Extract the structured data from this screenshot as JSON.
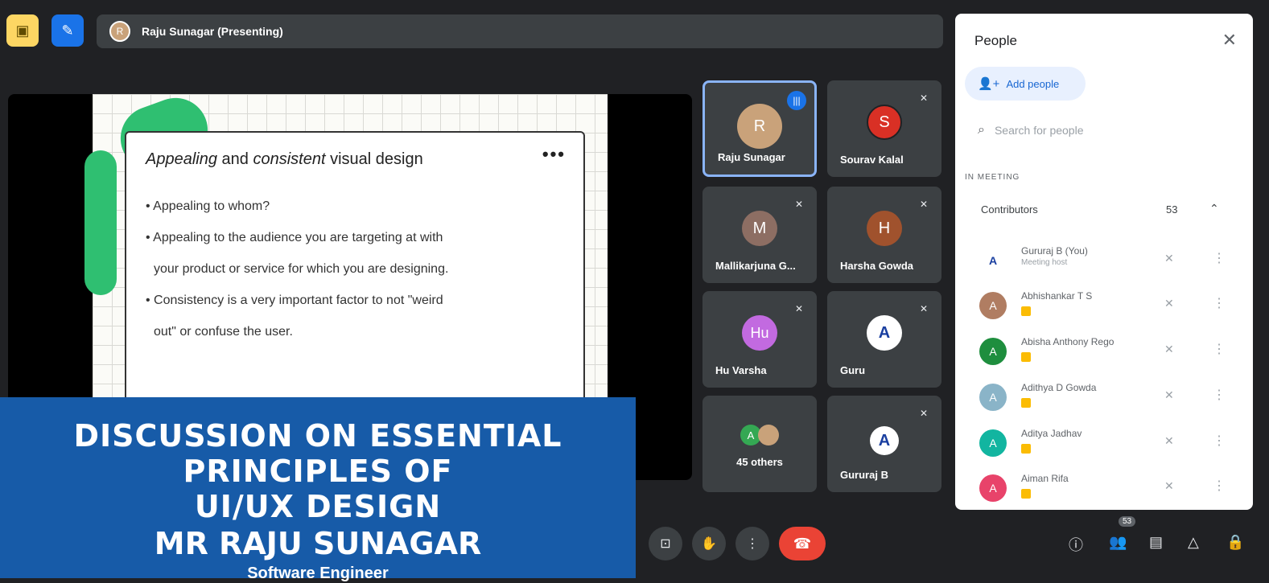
{
  "topbar": {
    "presenter_label": "Raju Sunagar (Presenting)",
    "presenter_initial": "R"
  },
  "slide": {
    "title_part1": "Appealing",
    "title_part2": " and ",
    "title_part3": "consistent",
    "title_part4": " visual design",
    "menu_dots": "•••",
    "bullets": [
      "• Appealing to whom?",
      "• Appealing to the audience you are targeting at with",
      "your product or service for which you are designing.",
      "• Consistency is a very important factor to not \"weird",
      "out\" or confuse the user."
    ]
  },
  "tiles": [
    {
      "name": "Raju Sunagar",
      "initial": "R",
      "color": "#c9a27a"
    },
    {
      "name": "Sourav Kalal",
      "initial": "S",
      "color": "#d93025"
    },
    {
      "name": "Mallikarjuna G...",
      "initial": "M",
      "color": "#8d6e63"
    },
    {
      "name": "Harsha Gowda",
      "initial": "H",
      "color": "#a0522d"
    },
    {
      "name": "Hu Varsha",
      "initial": "Hu",
      "color": "#c26ae0"
    },
    {
      "name": "Guru",
      "initial": "A",
      "color": "#ffffff"
    },
    {
      "name": "45 others",
      "initial": "A",
      "color": "#34a853"
    },
    {
      "name": "Gururaj B",
      "initial": "A",
      "color": "#ffffff"
    }
  ],
  "panel": {
    "title": "People",
    "close": "✕",
    "add_people": "Add people",
    "search_placeholder": "Search for people",
    "section": "IN MEETING",
    "contributors_label": "Contributors",
    "contributors_count": "53",
    "people": [
      {
        "name": "Gururaj B (You)",
        "sub": "Meeting host",
        "initial": "A",
        "color": "#ffffff"
      },
      {
        "name": "Abhishankar T S",
        "sub": "",
        "initial": "A",
        "color": "#b07d62"
      },
      {
        "name": "Abisha Anthony Rego",
        "sub": "",
        "initial": "A",
        "color": "#1e8e3e"
      },
      {
        "name": "Adithya D Gowda",
        "sub": "",
        "initial": "A",
        "color": "#8ab4c8"
      },
      {
        "name": "Aditya Jadhav",
        "sub": "",
        "initial": "A",
        "color": "#12b5a0"
      },
      {
        "name": "Aiman Rifa",
        "sub": "",
        "initial": "A",
        "color": "#e8436a"
      }
    ]
  },
  "controls": {
    "people_count": "53"
  },
  "banner": {
    "line1": "DISCUSSION ON ESSENTIAL PRINCIPLES OF",
    "line2": "UI/UX DESIGN",
    "line3": "MR RAJU SUNAGAR",
    "line4": "Software Engineer"
  }
}
